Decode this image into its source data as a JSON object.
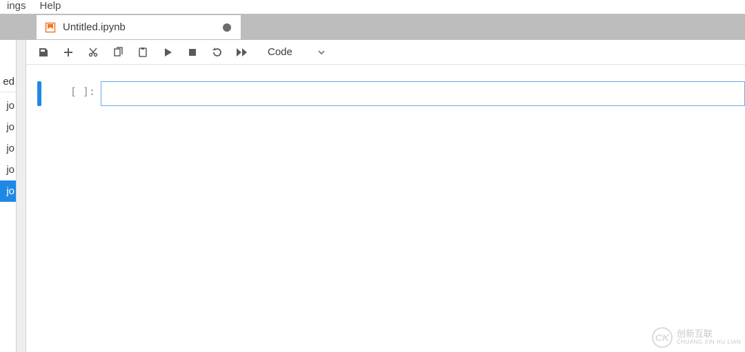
{
  "menu": {
    "items": [
      "ings",
      "Help"
    ]
  },
  "tab": {
    "title": "Untitled.ipynb",
    "dirty": true
  },
  "toolbar": {
    "cell_type": "Code"
  },
  "sidebar": {
    "header_fragment": "ed",
    "items": [
      {
        "label": "jo",
        "selected": false
      },
      {
        "label": "jo",
        "selected": false
      },
      {
        "label": "jo",
        "selected": false
      },
      {
        "label": "jo",
        "selected": false
      },
      {
        "label": "jo",
        "selected": true
      }
    ]
  },
  "cell": {
    "prompt": "[ ]:",
    "source": ""
  },
  "watermark": {
    "logo": "CK",
    "main": "创新互联",
    "sub": "CHUANG XIN HU LIAN"
  }
}
